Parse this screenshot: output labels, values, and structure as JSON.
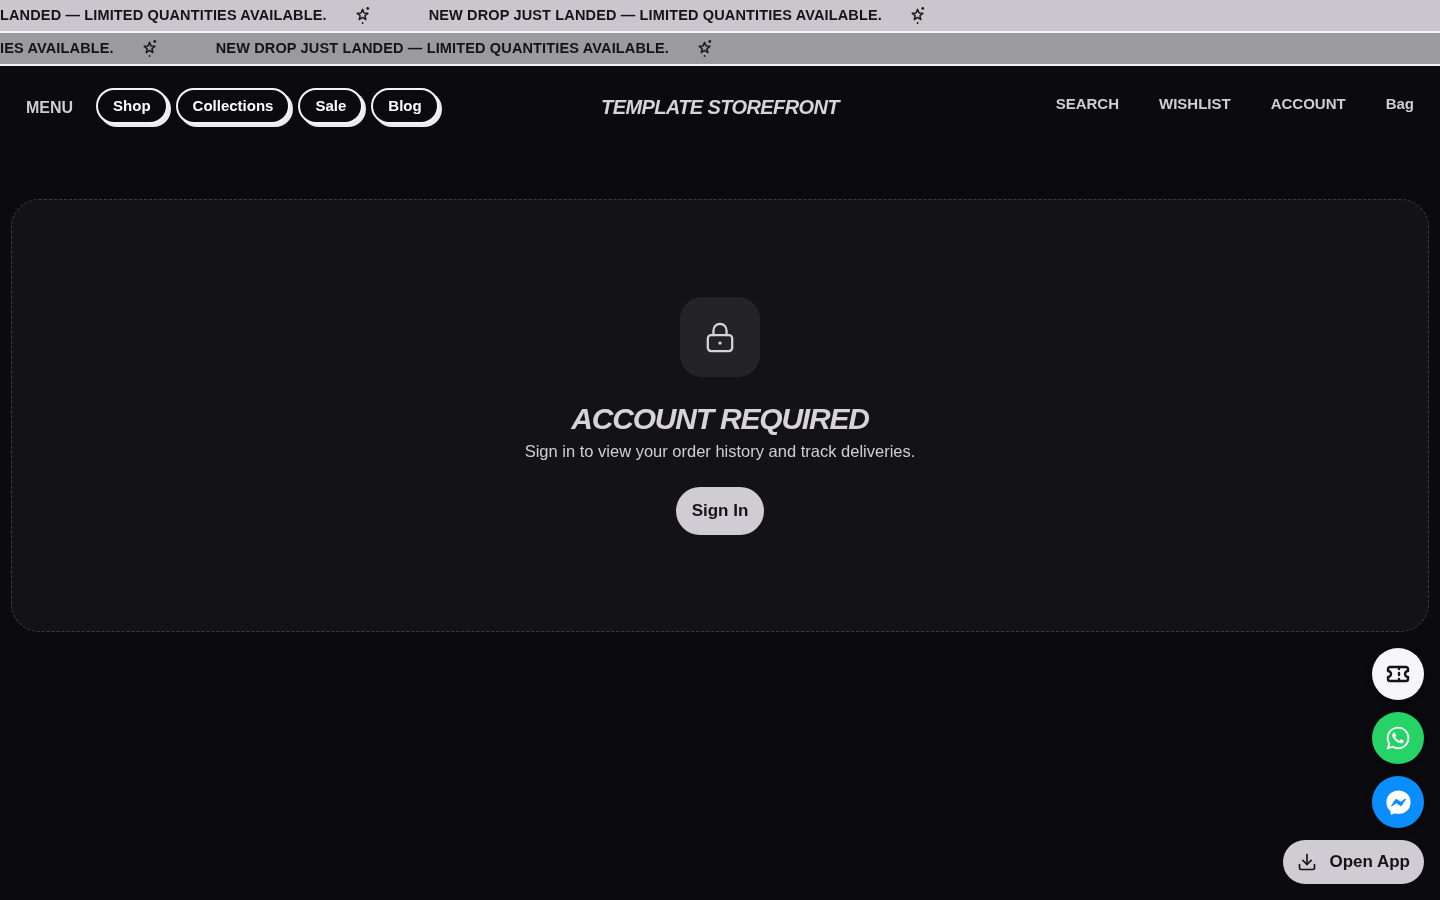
{
  "announcement_bar": {
    "rows": [
      {
        "items": [
          "LANDED — LIMITED QUANTITIES AVAILABLE.",
          "NEW DROP JUST LANDED — LIMITED QUANTITIES AVAILABLE."
        ]
      },
      {
        "items": [
          "IES AVAILABLE.",
          "NEW DROP JUST LANDED — LIMITED QUANTITIES AVAILABLE."
        ]
      }
    ]
  },
  "header": {
    "menu_label": "MENU",
    "nav_pills": [
      "Shop",
      "Collections",
      "Sale",
      "Blog"
    ],
    "logo": "TEMPLATE STOREFRONT",
    "actions": [
      "SEARCH",
      "WISHLIST",
      "ACCOUNT",
      "Bag"
    ]
  },
  "account_gate": {
    "title": "ACCOUNT REQUIRED",
    "message": "Sign in to view your order history and track deliveries.",
    "button": "Sign In"
  },
  "open_app_button": "Open App"
}
